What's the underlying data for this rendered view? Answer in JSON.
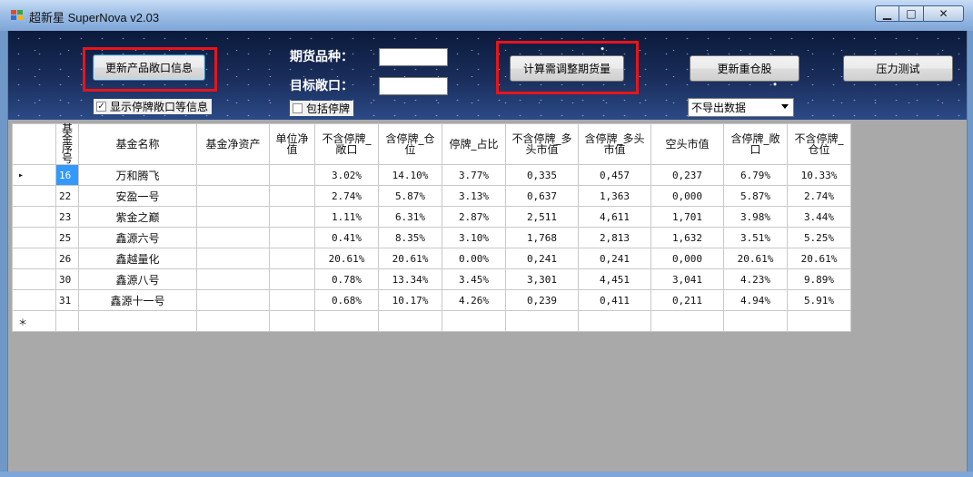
{
  "window": {
    "title": "超新星 SuperNova v2.03",
    "min_glyph": "▁",
    "max_glyph": "□",
    "close_glyph": "✕"
  },
  "toolbar": {
    "update_exposure_button": "更新产品敞口信息",
    "show_suspended_checkbox": "显示停牌敞口等信息",
    "show_suspended_checked": true,
    "futures_variety_label": "期货品种：",
    "futures_variety_value": "",
    "target_exposure_label": "目标敞口：",
    "target_exposure_value": "",
    "include_suspended_checkbox": "包括停牌",
    "include_suspended_checked": false,
    "calc_button": "计算需调整期货量",
    "update_heavy_button": "更新重仓股",
    "stress_test_button": "压力测试",
    "export_select": "不导出数据"
  },
  "grid": {
    "columns": [
      "基金序号",
      "基金名称",
      "基金净资产",
      "单位净值",
      "不含停牌_敞口",
      "含停牌_仓位",
      "停牌_占比",
      "不含停牌_多头市值",
      "含停牌_多头市值",
      "空头市值",
      "含停牌_敞口",
      "不含停牌_仓位"
    ],
    "current_row_marker": "▸",
    "new_row_marker": "＊",
    "rows": [
      {
        "id": "16",
        "name": "万和腾飞",
        "nav": "",
        "unit": "",
        "c1": "3.02%",
        "c2": "14.10%",
        "c3": "3.77%",
        "c4": "0,335",
        "c5": "0,457",
        "c6": "0,237",
        "c7": "6.79%",
        "c8": "10.33%"
      },
      {
        "id": "22",
        "name": "安盈一号",
        "nav": "",
        "unit": "",
        "c1": "2.74%",
        "c2": "5.87%",
        "c3": "3.13%",
        "c4": "0,637",
        "c5": "1,363",
        "c6": "0,000",
        "c7": "5.87%",
        "c8": "2.74%"
      },
      {
        "id": "23",
        "name": "紫金之巅",
        "nav": "",
        "unit": "",
        "c1": "1.11%",
        "c2": "6.31%",
        "c3": "2.87%",
        "c4": "2,511",
        "c5": "4,611",
        "c6": "1,701",
        "c7": "3.98%",
        "c8": "3.44%"
      },
      {
        "id": "25",
        "name": "鑫源六号",
        "nav": "",
        "unit": "",
        "c1": "0.41%",
        "c2": "8.35%",
        "c3": "3.10%",
        "c4": "1,768",
        "c5": "2,813",
        "c6": "1,632",
        "c7": "3.51%",
        "c8": "5.25%"
      },
      {
        "id": "26",
        "name": "鑫越量化",
        "nav": "",
        "unit": "",
        "c1": "20.61%",
        "c2": "20.61%",
        "c3": "0.00%",
        "c4": "0,241",
        "c5": "0,241",
        "c6": "0,000",
        "c7": "20.61%",
        "c8": "20.61%"
      },
      {
        "id": "30",
        "name": "鑫源八号",
        "nav": "",
        "unit": "",
        "c1": "0.78%",
        "c2": "13.34%",
        "c3": "3.45%",
        "c4": "3,301",
        "c5": "4,451",
        "c6": "3,041",
        "c7": "4.23%",
        "c8": "9.89%"
      },
      {
        "id": "31",
        "name": "鑫源十一号",
        "nav": "",
        "unit": "",
        "c1": "0.68%",
        "c2": "10.17%",
        "c3": "4.26%",
        "c4": "0,239",
        "c5": "0,411",
        "c6": "0,211",
        "c7": "4.94%",
        "c8": "5.91%"
      }
    ]
  },
  "colors": {
    "highlight_box": "#e8141a",
    "selected_cell": "#3399ff",
    "grid_background": "#a9a9a9"
  }
}
